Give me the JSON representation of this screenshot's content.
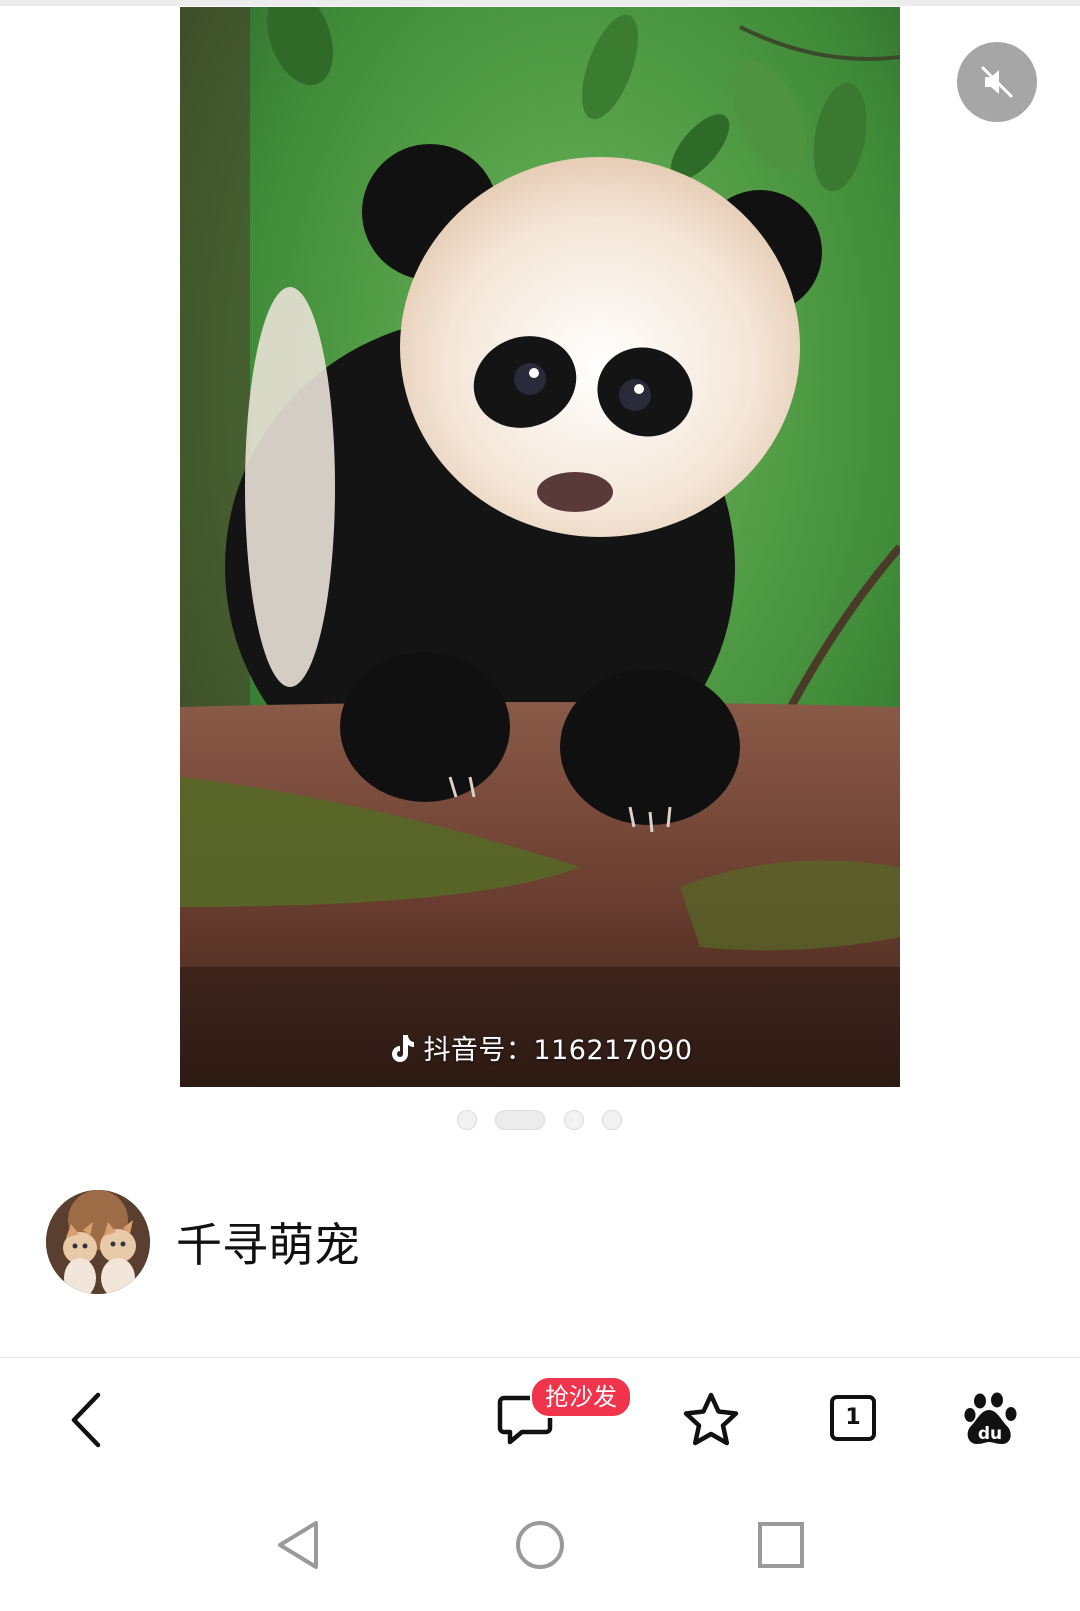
{
  "post": {
    "watermark_text": "抖音号：116217090",
    "carousel": {
      "total": 4,
      "active_index": 1
    },
    "mute_icon": "speaker-muted-icon"
  },
  "author": {
    "name": "千寻萌宠"
  },
  "toolbar": {
    "back_icon": "chevron-left-icon",
    "comment_icon": "comment-bubble-icon",
    "comment_badge": "抢沙发",
    "favorite_icon": "star-outline-icon",
    "tab_count": "1",
    "baidu_icon": "baidu-paw-icon"
  },
  "system_nav": {
    "back_icon": "triangle-back-icon",
    "home_icon": "circle-home-icon",
    "recents_icon": "square-recents-icon"
  },
  "colors": {
    "badge": "#f0344b",
    "icon": "#111111",
    "system_nav": "#9a9a9a"
  }
}
